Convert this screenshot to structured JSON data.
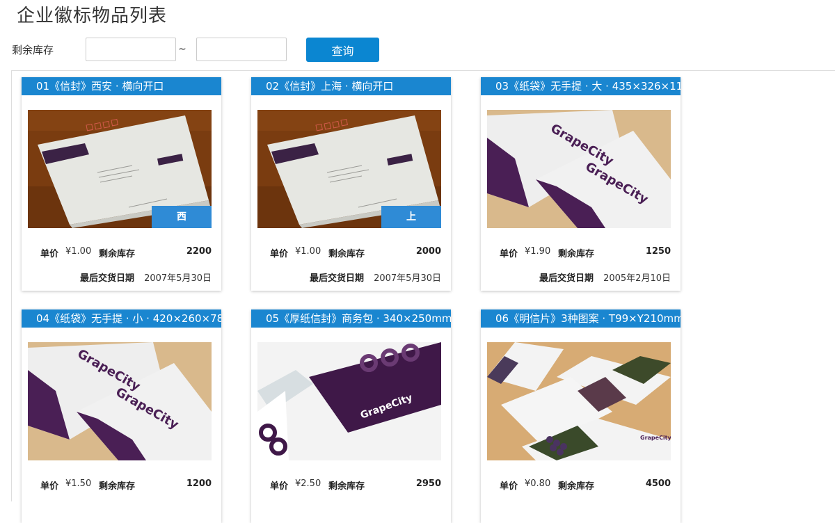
{
  "page": {
    "title": "企业徽标物品列表"
  },
  "filter": {
    "label": "剩余库存",
    "separator": "~",
    "min_value": "",
    "max_value": "",
    "button_label": "查询"
  },
  "labels": {
    "price": "单价",
    "stock": "剩余库存",
    "last_delivery": "最后交货日期"
  },
  "colors": {
    "accent": "#0b86d1",
    "title_bar": "#1a86d0",
    "brand_purple": "#3f1848"
  },
  "products": [
    {
      "title": "01《信封》西安 · 横向开口",
      "image": "envelope",
      "badge": "西 安",
      "price": "¥1.00",
      "stock": "2200",
      "last_delivery": "2007年5月30日"
    },
    {
      "title": "02《信封》上海 · 横向开口",
      "image": "envelope",
      "badge": "上 海",
      "price": "¥1.00",
      "stock": "2000",
      "last_delivery": "2007年5月30日"
    },
    {
      "title": "03《纸袋》无手提 · 大 · 435×326×11",
      "image": "paper-bag",
      "price": "¥1.90",
      "stock": "1250",
      "last_delivery": "2005年2月10日"
    },
    {
      "title": "04《纸袋》无手提 · 小 · 420×260×78",
      "image": "paper-bag",
      "price": "¥1.50",
      "stock": "1200"
    },
    {
      "title": "05《厚纸信封》商务包 · 340×250mm",
      "image": "thick-envelope",
      "price": "¥2.50",
      "stock": "2950"
    },
    {
      "title": "06《明信片》3种图案 · T99×Y210mm",
      "image": "postcards",
      "price": "¥0.80",
      "stock": "4500"
    }
  ]
}
